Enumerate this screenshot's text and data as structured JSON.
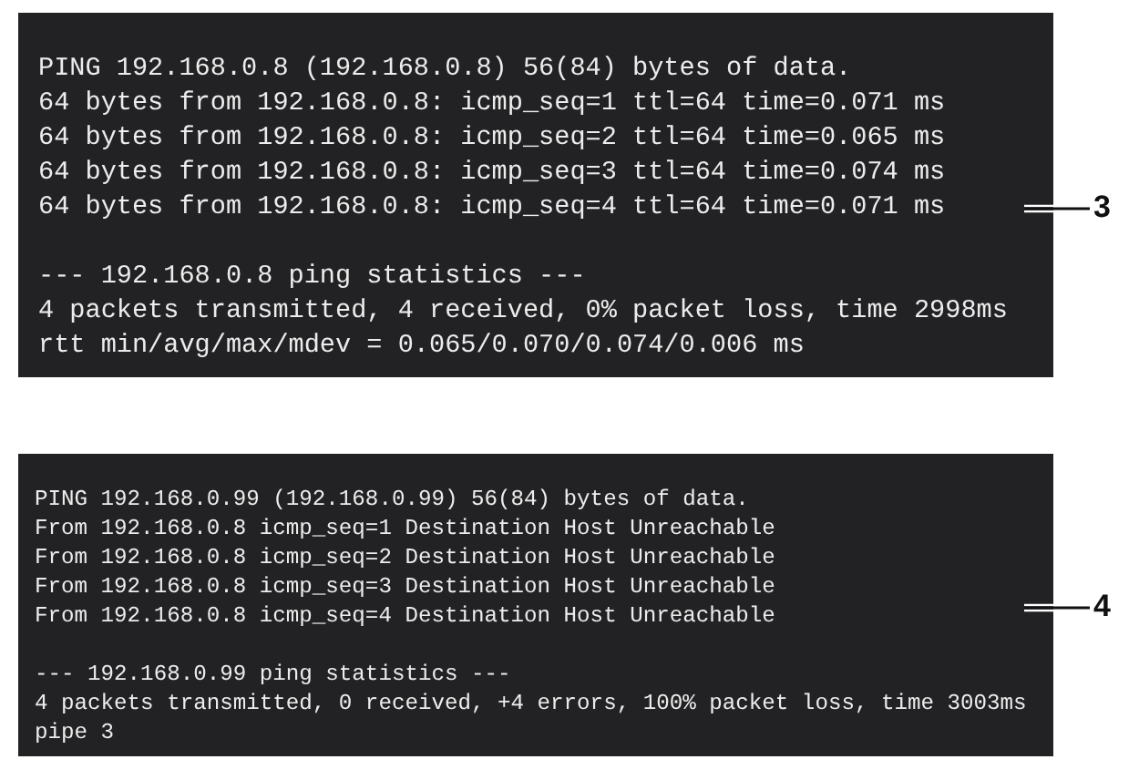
{
  "terminals": [
    {
      "kind": "large",
      "callout": "3",
      "blocks": [
        [
          "PING 192.168.0.8 (192.168.0.8) 56(84) bytes of data.",
          "64 bytes from 192.168.0.8: icmp_seq=1 ttl=64 time=0.071 ms",
          "64 bytes from 192.168.0.8: icmp_seq=2 ttl=64 time=0.065 ms",
          "64 bytes from 192.168.0.8: icmp_seq=3 ttl=64 time=0.074 ms",
          "64 bytes from 192.168.0.8: icmp_seq=4 ttl=64 time=0.071 ms"
        ],
        [
          "--- 192.168.0.8 ping statistics ---",
          "4 packets transmitted, 4 received, 0% packet loss, time 2998ms",
          "rtt min/avg/max/mdev = 0.065/0.070/0.074/0.006 ms"
        ]
      ]
    },
    {
      "kind": "small",
      "callout": "4",
      "blocks": [
        [
          "PING 192.168.0.99 (192.168.0.99) 56(84) bytes of data.",
          "From 192.168.0.8 icmp_seq=1 Destination Host Unreachable",
          "From 192.168.0.8 icmp_seq=2 Destination Host Unreachable",
          "From 192.168.0.8 icmp_seq=3 Destination Host Unreachable",
          "From 192.168.0.8 icmp_seq=4 Destination Host Unreachable"
        ],
        [
          "--- 192.168.0.99 ping statistics ---",
          "4 packets transmitted, 0 received, +4 errors, 100% packet loss, time 3003ms",
          "pipe 3"
        ]
      ]
    }
  ]
}
